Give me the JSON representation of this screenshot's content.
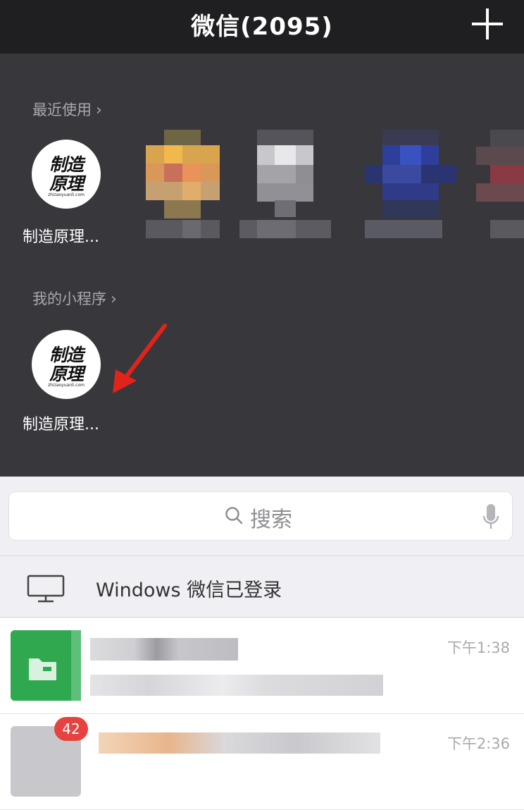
{
  "header": {
    "title": "微信(2095)",
    "add_icon": "plus-icon"
  },
  "recent": {
    "label": "最近使用",
    "items": [
      {
        "label": "制造原理...",
        "logo_line1": "制造",
        "logo_line2": "原理",
        "logo_domain": "zhizaoyuanli.com"
      }
    ]
  },
  "mini_programs": {
    "label": "我的小程序",
    "items": [
      {
        "label": "制造原理...",
        "logo_line1": "制造",
        "logo_line2": "原理",
        "logo_domain": "zhizaoyuanli.com"
      }
    ]
  },
  "search": {
    "placeholder": "搜索",
    "icons": [
      "search-icon",
      "microphone-icon"
    ]
  },
  "windows_login": {
    "text": "Windows 微信已登录",
    "icon": "monitor-icon"
  },
  "chats": [
    {
      "time": "下午1:38"
    },
    {
      "time": "下午2:36",
      "badge": "42"
    }
  ],
  "colors": {
    "top_bar": "#1f1f22",
    "panel": "#38373c",
    "background": "#efeff4",
    "badge": "#e64340",
    "arrow": "#e2231a",
    "file_avatar": "#2fa84f"
  }
}
